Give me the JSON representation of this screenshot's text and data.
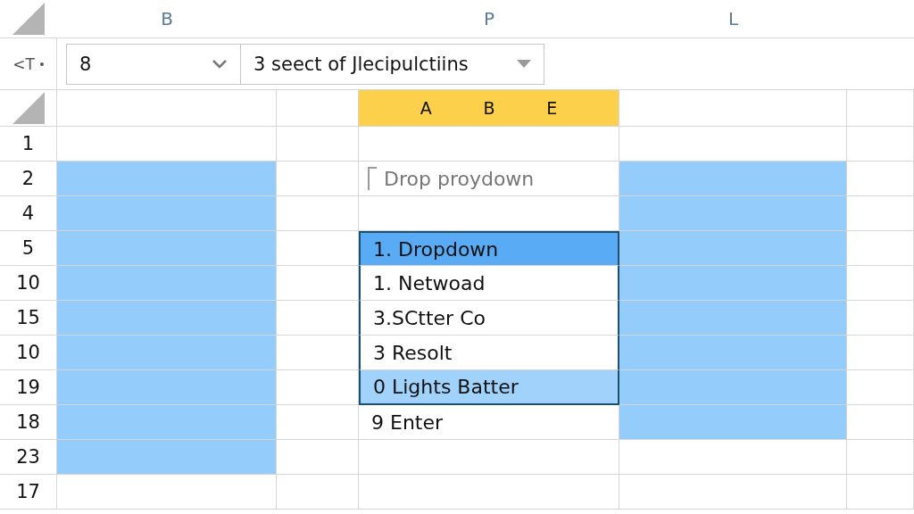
{
  "column_letters": [
    "B",
    "P",
    "L"
  ],
  "toolbar": {
    "selector_label": "<T",
    "name_box": {
      "value": "8"
    },
    "formula_box": {
      "value": "3 seect of Jlecipulctiins"
    }
  },
  "header_row": {
    "labels": [
      "A",
      "B",
      "E"
    ]
  },
  "rows": [
    {
      "label": "1",
      "col1_highlighted": false,
      "col4_highlighted": false
    },
    {
      "label": "2",
      "col1_highlighted": true,
      "col4_highlighted": true,
      "cell": {
        "kind": "hint",
        "text": "Drop proydown"
      }
    },
    {
      "label": "4",
      "col1_highlighted": true,
      "col4_highlighted": true
    },
    {
      "label": "5",
      "col1_highlighted": true,
      "col4_highlighted": true,
      "cell": {
        "kind": "option",
        "text": "1. Dropdown",
        "selected": true,
        "hovered": false
      }
    },
    {
      "label": "10",
      "col1_highlighted": true,
      "col4_highlighted": true,
      "cell": {
        "kind": "option",
        "text": "1. Netwoad",
        "selected": false,
        "hovered": false
      }
    },
    {
      "label": "15",
      "col1_highlighted": true,
      "col4_highlighted": true,
      "cell": {
        "kind": "option",
        "text": "3.SCtter Co",
        "selected": false,
        "hovered": false
      }
    },
    {
      "label": "10",
      "col1_highlighted": true,
      "col4_highlighted": true,
      "cell": {
        "kind": "option",
        "text": "3 Resolt",
        "selected": false,
        "hovered": false
      }
    },
    {
      "label": "19",
      "col1_highlighted": true,
      "col4_highlighted": true,
      "cell": {
        "kind": "option",
        "text": "0 Lights Batter",
        "selected": false,
        "hovered": true
      }
    },
    {
      "label": "18",
      "col1_highlighted": true,
      "col4_highlighted": true,
      "cell": {
        "kind": "text",
        "text": "9 Enter"
      }
    },
    {
      "label": "23",
      "col1_highlighted": true,
      "col4_highlighted": false
    },
    {
      "label": "17",
      "col1_highlighted": false,
      "col4_highlighted": false
    }
  ]
}
